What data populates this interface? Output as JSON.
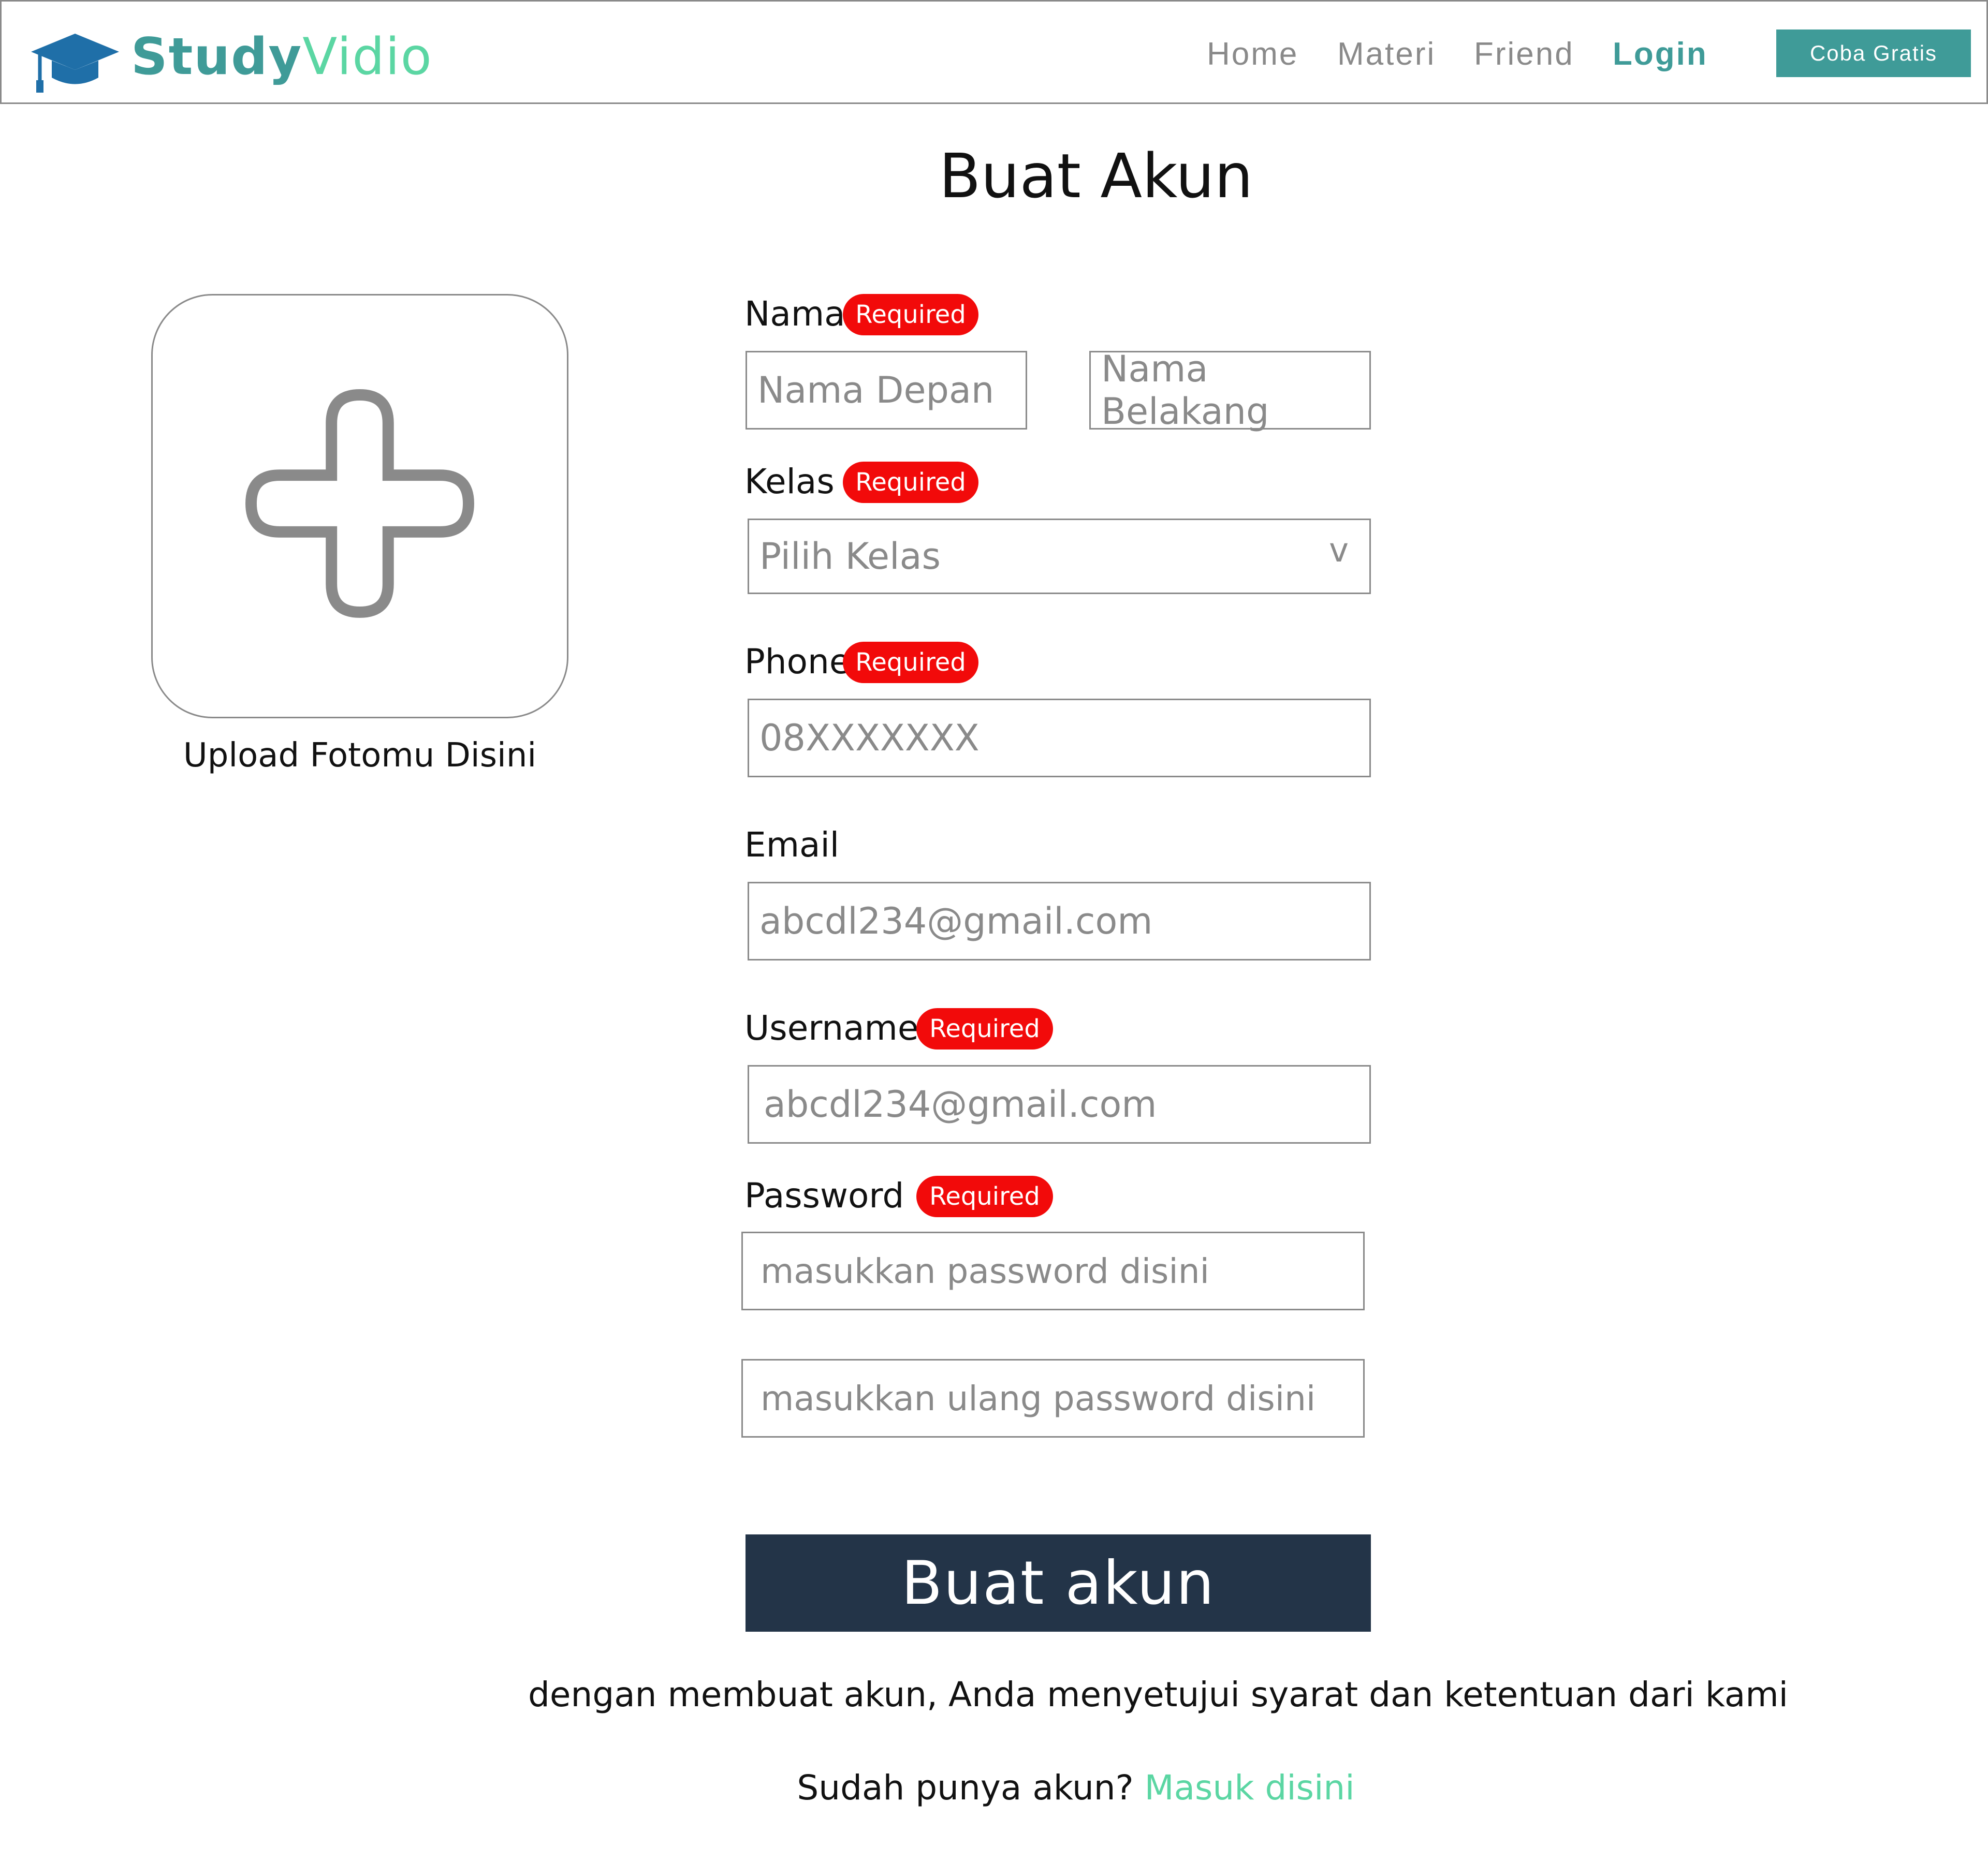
{
  "brand": {
    "name_bold": "Study",
    "name_light": "Vidio"
  },
  "nav": {
    "home": "Home",
    "materi": "Materi",
    "friend": "Friend",
    "login": "Login",
    "cta": "Coba Gratis"
  },
  "page_title": "Buat Akun",
  "upload": {
    "label": "Upload Fotomu Disini"
  },
  "form": {
    "required_badge": "Required",
    "nama": {
      "label": "Nama",
      "first_placeholder": "Nama Depan",
      "last_placeholder": "Nama Belakang"
    },
    "kelas": {
      "label": "Kelas",
      "placeholder": "Pilih Kelas",
      "chevron": "v"
    },
    "phone": {
      "label": "Phone",
      "placeholder": "08XXXXXXX"
    },
    "email": {
      "label": "Email",
      "placeholder": "abcdl234@gmail.com"
    },
    "username": {
      "label": "Username",
      "placeholder": "abcdl234@gmail.com"
    },
    "password": {
      "label": "Password",
      "placeholder": "masukkan password disini",
      "confirm_placeholder": "masukkan ulang password disini"
    },
    "submit": "Buat akun"
  },
  "footer": {
    "terms": "dengan membuat akun, Anda menyetujui syarat dan ketentuan dari kami",
    "have_account": "Sudah punya akun?",
    "signin_link": "Masuk disini"
  },
  "colors": {
    "brand_teal": "#3f9b98",
    "brand_green": "#5bd6a3",
    "required_red": "#f20a0a",
    "submit_navy": "#233448",
    "logo_blue": "#1f6fa8"
  }
}
